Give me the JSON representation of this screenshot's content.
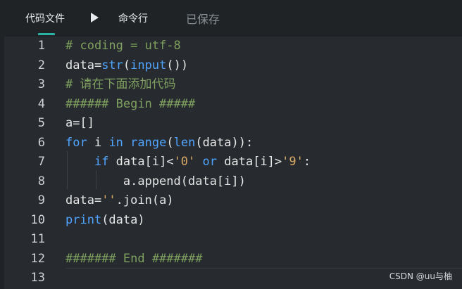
{
  "topbar": {
    "tab_file": "代码文件",
    "tab_cmd": "命令行",
    "status": "已保存"
  },
  "colors": {
    "background": "#1f2326",
    "editor_bg": "#272b2f",
    "accent": "#2ab3a3",
    "keyword": "#4fa4ff",
    "comment": "#7fa05f",
    "string": "#d9a866"
  },
  "editor": {
    "line_numbers": [
      "1",
      "2",
      "3",
      "4",
      "5",
      "6",
      "7",
      "8",
      "9",
      "10",
      "11",
      "12",
      "13"
    ],
    "lines": [
      [
        {
          "t": "# coding = utf-8",
          "c": "comment"
        }
      ],
      [
        {
          "t": "data=",
          "c": "plain"
        },
        {
          "t": "str",
          "c": "fn"
        },
        {
          "t": "(",
          "c": "plain"
        },
        {
          "t": "input",
          "c": "fn"
        },
        {
          "t": "())",
          "c": "plain"
        }
      ],
      [
        {
          "t": "# 请在下面添加代码",
          "c": "comment"
        }
      ],
      [
        {
          "t": "###### Begin #####",
          "c": "comment"
        }
      ],
      [
        {
          "t": "a=[]",
          "c": "plain"
        }
      ],
      [
        {
          "t": "for",
          "c": "kw"
        },
        {
          "t": " i ",
          "c": "plain"
        },
        {
          "t": "in",
          "c": "kw"
        },
        {
          "t": " ",
          "c": "plain"
        },
        {
          "t": "range",
          "c": "fn"
        },
        {
          "t": "(",
          "c": "plain"
        },
        {
          "t": "len",
          "c": "fn"
        },
        {
          "t": "(data)):",
          "c": "plain"
        }
      ],
      [
        {
          "t": "    ",
          "c": "plain"
        },
        {
          "t": "if",
          "c": "kw"
        },
        {
          "t": " data[i]<",
          "c": "plain"
        },
        {
          "t": "'0'",
          "c": "str"
        },
        {
          "t": " ",
          "c": "plain"
        },
        {
          "t": "or",
          "c": "kw"
        },
        {
          "t": " data[i]>",
          "c": "plain"
        },
        {
          "t": "'9'",
          "c": "str"
        },
        {
          "t": ":",
          "c": "plain"
        }
      ],
      [
        {
          "t": "        a.append(data[i])",
          "c": "plain"
        }
      ],
      [
        {
          "t": "data=",
          "c": "plain"
        },
        {
          "t": "''",
          "c": "str"
        },
        {
          "t": ".join(a)",
          "c": "plain"
        }
      ],
      [
        {
          "t": "print",
          "c": "fn"
        },
        {
          "t": "(data)",
          "c": "plain"
        }
      ],
      [
        {
          "t": "",
          "c": "plain"
        }
      ],
      [
        {
          "t": "####### End #######",
          "c": "comment"
        }
      ],
      [
        {
          "t": "",
          "c": "plain"
        }
      ]
    ]
  },
  "watermark": "CSDN @uu与柚"
}
